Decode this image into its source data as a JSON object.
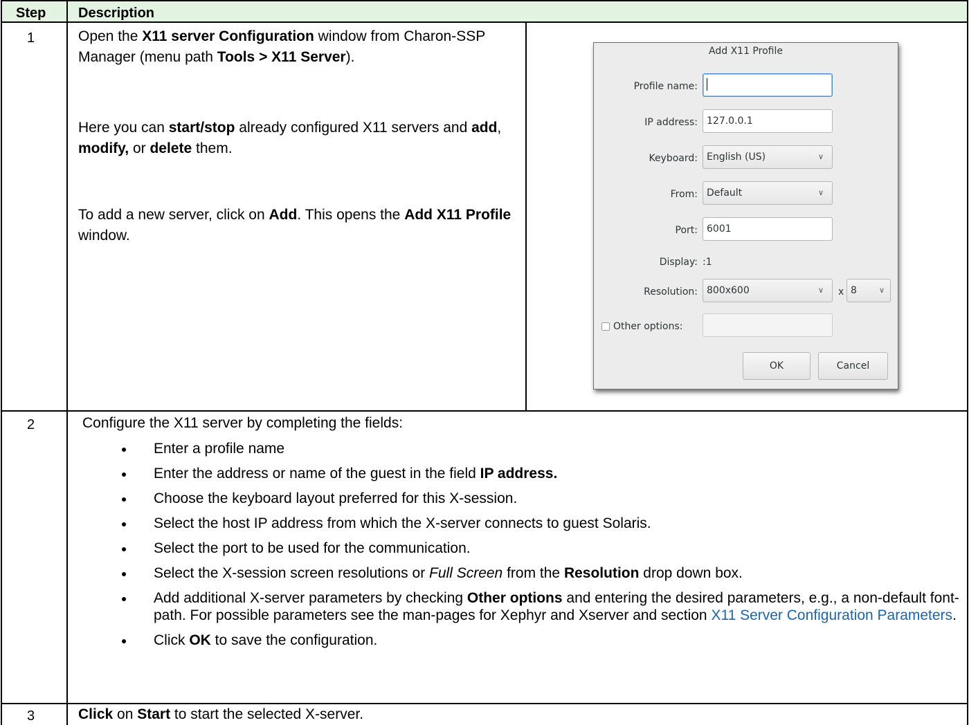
{
  "header": {
    "step": "Step",
    "description": "Description"
  },
  "rows": [
    {
      "step": "1",
      "p1": [
        "Open the ",
        "X11 server Configuration",
        " window from Charon-SSP Manager (menu path ",
        "Tools > X11 Server",
        ")."
      ],
      "p2": [
        "Here you can ",
        "start/stop",
        " already configured X11 servers and ",
        "add",
        ", ",
        "modify,",
        " or ",
        "delete",
        " them."
      ],
      "p3": [
        "To add a new server, click on ",
        "Add",
        ". This opens the ",
        "Add X11 Profile",
        " window."
      ]
    },
    {
      "step": "2",
      "intro": "Configure the X11 server by completing the fields:",
      "bullets": [
        {
          "text": "Enter a profile name"
        },
        {
          "pre": "Enter the address or name of the guest in the field ",
          "bold": "IP address."
        },
        {
          "text": "Choose the keyboard layout preferred for this X-session."
        },
        {
          "text": "Select the host IP address from which the X-server connects to guest Solaris."
        },
        {
          "text": "Select the port to be used for the communication."
        },
        {
          "pre": "Select the X-session screen resolutions or ",
          "italic": "Full Screen",
          "mid": " from the ",
          "bold": "Resolution",
          "post": " drop down box."
        },
        {
          "pre": "Add additional X-server parameters by checking ",
          "bold": "Other options",
          "post": " and entering the desired parameters, e.g., a non-default font-path. For possible parameters see the man-pages for Xephyr and Xserver and section ",
          "link": "X11 Server Configuration Parameters",
          "end": "."
        },
        {
          "pre": "Click ",
          "bold": "OK",
          "post": " to save the configuration."
        }
      ]
    },
    {
      "step": "3",
      "b1": "Click",
      "t1": " on ",
      "b2": "Start",
      "t2": " to start the selected X-server."
    }
  ],
  "dialog": {
    "title": "Add X11 Profile",
    "profile_name_label": "Profile name:",
    "profile_name_value": "",
    "ip_label": "IP address:",
    "ip_value": "127.0.0.1",
    "keyboard_label": "Keyboard:",
    "keyboard_value": "English (US)",
    "from_label": "From:",
    "from_value": "Default",
    "port_label": "Port:",
    "port_value": "6001",
    "display_label": "Display:",
    "display_value": ":1",
    "resolution_label": "Resolution:",
    "resolution_value": "800x600",
    "x_sep": "x",
    "depth_value": "8",
    "other_label": "Other options:",
    "other_checked": false,
    "ok": "OK",
    "cancel": "Cancel",
    "chevron": "chevron-down-icon"
  }
}
